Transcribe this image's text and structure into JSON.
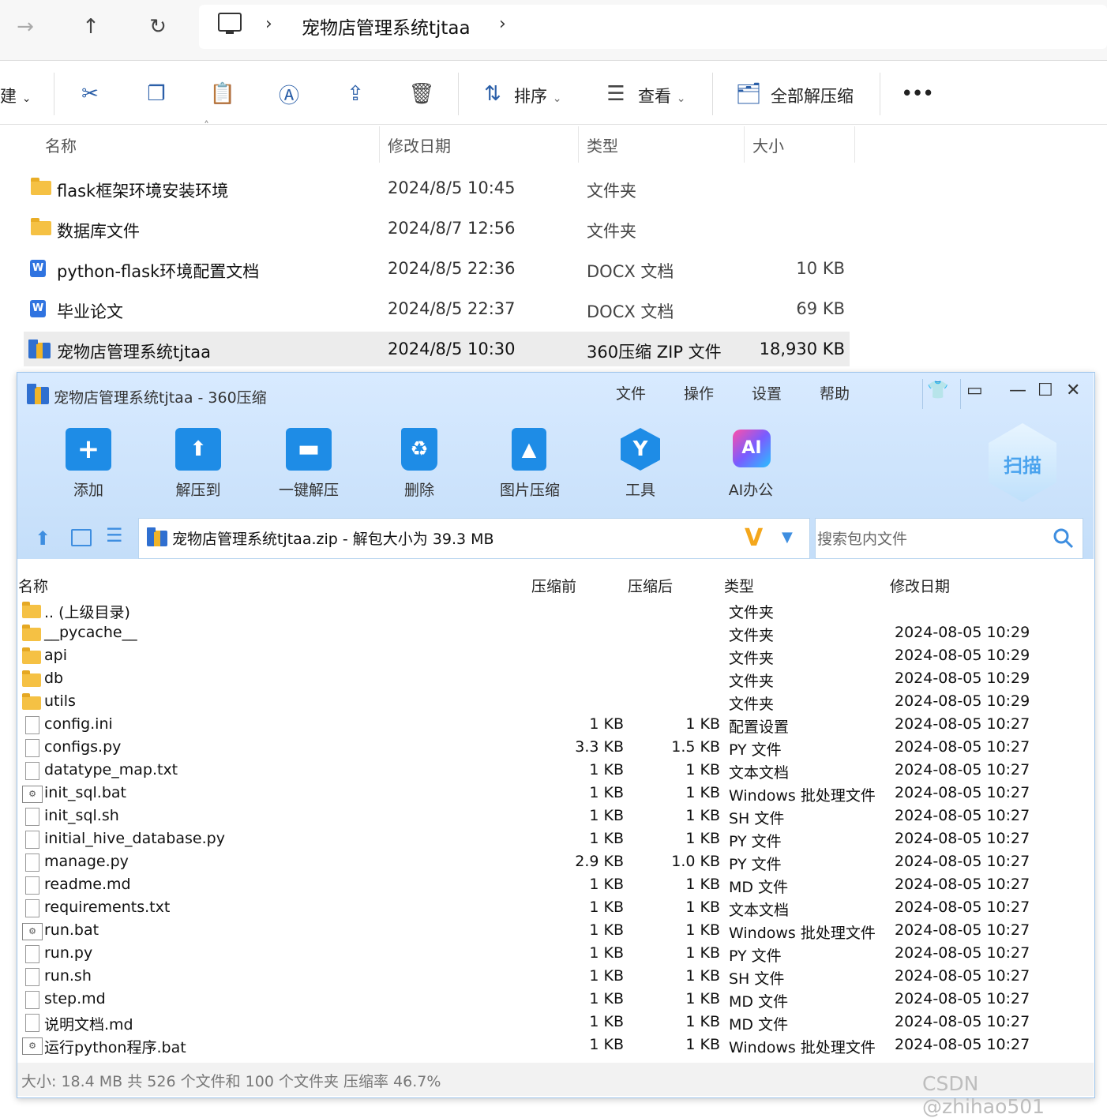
{
  "explorer": {
    "nav": {
      "forward": "→",
      "up": "↑",
      "refresh": "↻"
    },
    "address_path": "宠物店管理系统tjtaa",
    "toolbar": {
      "new_label": "建",
      "sort_label": "排序",
      "view_label": "查看",
      "extract_all_label": "全部解压缩",
      "more_label": "•••"
    },
    "columns": {
      "name": "名称",
      "date": "修改日期",
      "type": "类型",
      "size": "大小"
    },
    "files": [
      {
        "name": "flask框架环境安装环境",
        "date": "2024/8/5 10:45",
        "type": "文件夹",
        "size": "",
        "icon": "folder-icon"
      },
      {
        "name": "数据库文件",
        "date": "2024/8/7 12:56",
        "type": "文件夹",
        "size": "",
        "icon": "folder-icon"
      },
      {
        "name": "python-flask环境配置文档",
        "date": "2024/8/5 22:36",
        "type": "DOCX 文档",
        "size": "10 KB",
        "icon": "word-doc-icon"
      },
      {
        "name": "毕业论文",
        "date": "2024/8/5 22:37",
        "type": "DOCX 文档",
        "size": "69 KB",
        "icon": "word-doc-icon"
      },
      {
        "name": "宠物店管理系统tjtaa",
        "date": "2024/8/5 10:30",
        "type": "360压缩 ZIP 文件",
        "size": "18,930 KB",
        "icon": "zip-archive-icon"
      }
    ]
  },
  "zip": {
    "title": "宠物店管理系统tjtaa - 360压缩",
    "menu": [
      "文件",
      "操作",
      "设置",
      "帮助"
    ],
    "tools": [
      "添加",
      "解压到",
      "一键解压",
      "删除",
      "图片压缩",
      "工具",
      "AI办公"
    ],
    "scan_label": "扫描",
    "ai_badge": "AI",
    "path_text": "宠物店管理系统tjtaa.zip - 解包大小为 39.3 MB",
    "search_placeholder": "搜索包内文件",
    "columns": {
      "name": "名称",
      "before": "压缩前",
      "after": "压缩后",
      "type": "类型",
      "date": "修改日期"
    },
    "rows": [
      {
        "name": ".. (上级目录)",
        "before": "",
        "after": "",
        "type": "文件夹",
        "date": "",
        "icon": "folder"
      },
      {
        "name": "__pycache__",
        "before": "",
        "after": "",
        "type": "文件夹",
        "date": "2024-08-05 10:29",
        "icon": "folder"
      },
      {
        "name": "api",
        "before": "",
        "after": "",
        "type": "文件夹",
        "date": "2024-08-05 10:29",
        "icon": "folder"
      },
      {
        "name": "db",
        "before": "",
        "after": "",
        "type": "文件夹",
        "date": "2024-08-05 10:29",
        "icon": "folder"
      },
      {
        "name": "utils",
        "before": "",
        "after": "",
        "type": "文件夹",
        "date": "2024-08-05 10:29",
        "icon": "folder"
      },
      {
        "name": "config.ini",
        "before": "1 KB",
        "after": "1 KB",
        "type": "配置设置",
        "date": "2024-08-05 10:27",
        "icon": "doc"
      },
      {
        "name": "configs.py",
        "before": "3.3 KB",
        "after": "1.5 KB",
        "type": "PY 文件",
        "date": "2024-08-05 10:27",
        "icon": "doc"
      },
      {
        "name": "datatype_map.txt",
        "before": "1 KB",
        "after": "1 KB",
        "type": "文本文档",
        "date": "2024-08-05 10:27",
        "icon": "doc"
      },
      {
        "name": "init_sql.bat",
        "before": "1 KB",
        "after": "1 KB",
        "type": "Windows 批处理文件",
        "date": "2024-08-05 10:27",
        "icon": "bat"
      },
      {
        "name": "init_sql.sh",
        "before": "1 KB",
        "after": "1 KB",
        "type": "SH 文件",
        "date": "2024-08-05 10:27",
        "icon": "doc"
      },
      {
        "name": "initial_hive_database.py",
        "before": "1 KB",
        "after": "1 KB",
        "type": "PY 文件",
        "date": "2024-08-05 10:27",
        "icon": "doc"
      },
      {
        "name": "manage.py",
        "before": "2.9 KB",
        "after": "1.0 KB",
        "type": "PY 文件",
        "date": "2024-08-05 10:27",
        "icon": "doc"
      },
      {
        "name": "readme.md",
        "before": "1 KB",
        "after": "1 KB",
        "type": "MD 文件",
        "date": "2024-08-05 10:27",
        "icon": "doc"
      },
      {
        "name": "requirements.txt",
        "before": "1 KB",
        "after": "1 KB",
        "type": "文本文档",
        "date": "2024-08-05 10:27",
        "icon": "doc"
      },
      {
        "name": "run.bat",
        "before": "1 KB",
        "after": "1 KB",
        "type": "Windows 批处理文件",
        "date": "2024-08-05 10:27",
        "icon": "bat"
      },
      {
        "name": "run.py",
        "before": "1 KB",
        "after": "1 KB",
        "type": "PY 文件",
        "date": "2024-08-05 10:27",
        "icon": "doc"
      },
      {
        "name": "run.sh",
        "before": "1 KB",
        "after": "1 KB",
        "type": "SH 文件",
        "date": "2024-08-05 10:27",
        "icon": "doc"
      },
      {
        "name": "step.md",
        "before": "1 KB",
        "after": "1 KB",
        "type": "MD 文件",
        "date": "2024-08-05 10:27",
        "icon": "doc"
      },
      {
        "name": "说明文档.md",
        "before": "1 KB",
        "after": "1 KB",
        "type": "MD 文件",
        "date": "2024-08-05 10:27",
        "icon": "doc"
      },
      {
        "name": "运行python程序.bat",
        "before": "1 KB",
        "after": "1 KB",
        "type": "Windows 批处理文件",
        "date": "2024-08-05 10:27",
        "icon": "bat"
      }
    ],
    "status": "大小: 18.4 MB 共 526 个文件和 100 个文件夹 压缩率 46.7%"
  },
  "watermark": "CSDN @zhihao501"
}
